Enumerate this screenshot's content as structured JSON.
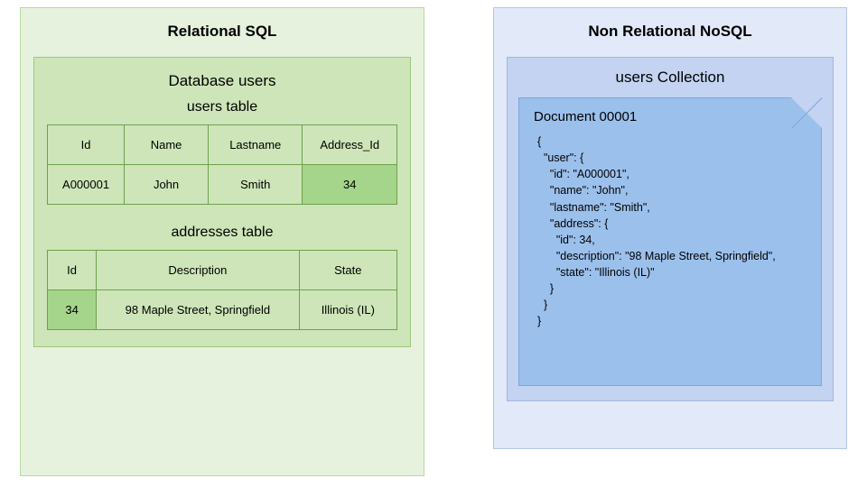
{
  "left": {
    "title": "Relational SQL",
    "db_title": "Database users",
    "users_table": {
      "title": "users table",
      "headers": [
        "Id",
        "Name",
        "Lastname",
        "Address_Id"
      ],
      "row": [
        "A000001",
        "John",
        "Smith",
        "34"
      ]
    },
    "addresses_table": {
      "title": "addresses table",
      "headers": [
        "Id",
        "Description",
        "State"
      ],
      "row": [
        "34",
        "98 Maple Street, Springfield",
        "Illinois (IL)"
      ]
    }
  },
  "right": {
    "title": "Non Relational NoSQL",
    "collection_title": "users Collection",
    "document_title": "Document 00001",
    "document_json": "{\n  \"user\": {\n    \"id\": \"A000001\",\n    \"name\": \"John\",\n    \"lastname\": \"Smith\",\n    \"address\": {\n      \"id\": 34,\n      \"description\": \"98 Maple Street, Springfield\",\n      \"state\": \"Illinois (IL)\"\n    }\n  }\n}"
  }
}
